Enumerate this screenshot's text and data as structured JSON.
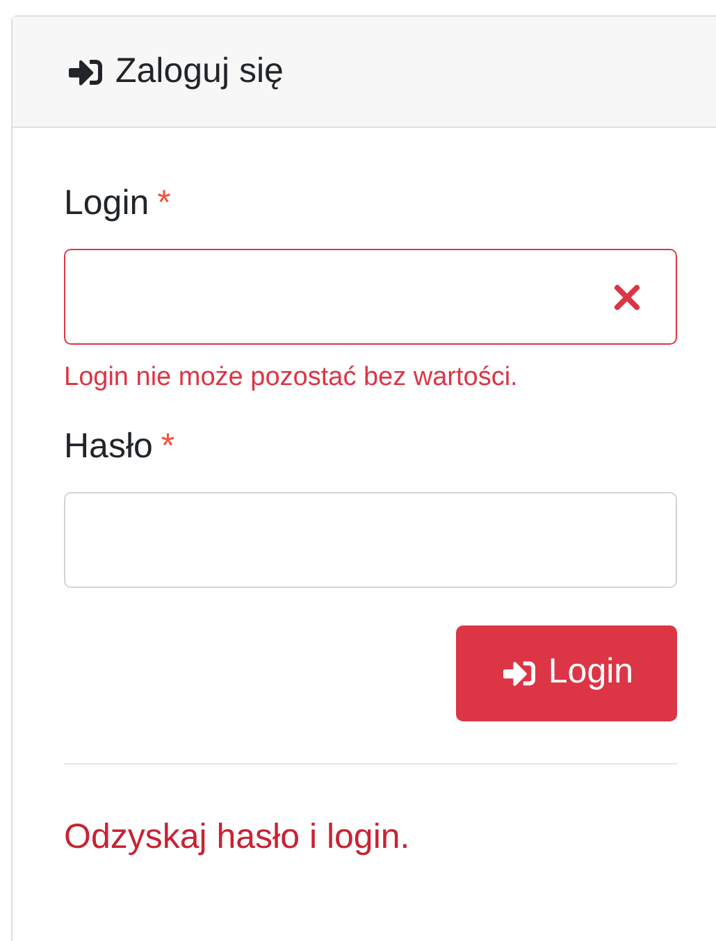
{
  "header": {
    "title": "Zaloguj się"
  },
  "fields": [
    {
      "label": "Login",
      "required_mark": "*",
      "invalid": true,
      "error": "Login nie może pozostać bez wartości."
    },
    {
      "label": "Hasło",
      "required_mark": "*",
      "invalid": false
    }
  ],
  "submit_button": {
    "label": "Login"
  },
  "recover_link": "Odzyskaj hasło i login."
}
